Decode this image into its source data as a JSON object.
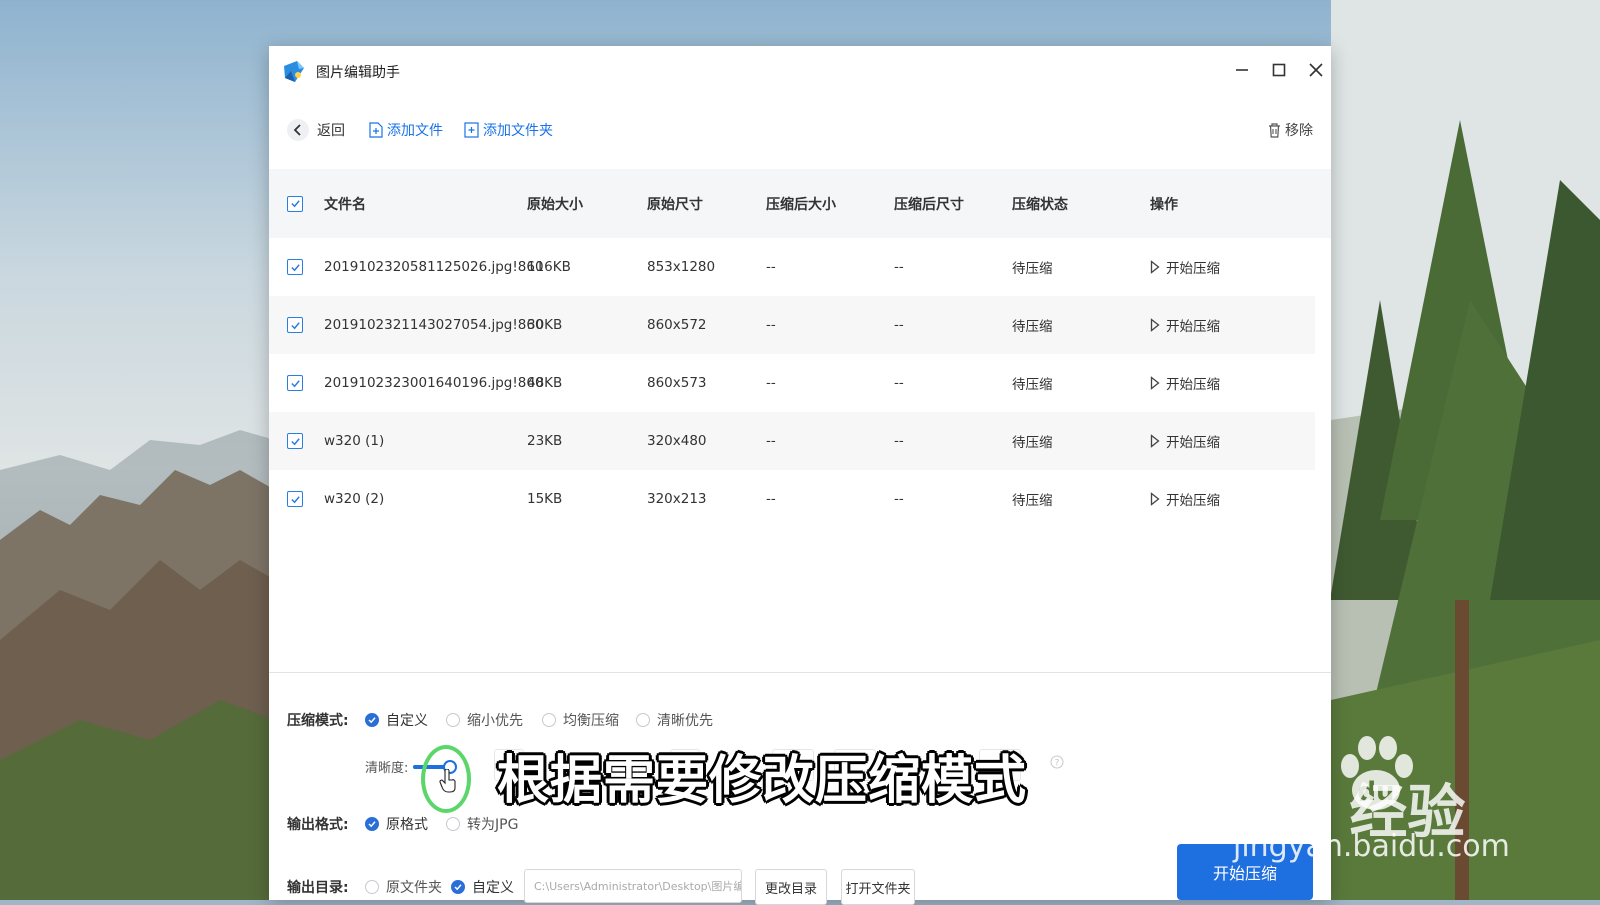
{
  "window": {
    "title": "图片编辑助手",
    "controls": {
      "minimize": "minimize-icon",
      "maximize": "maximize-icon",
      "close": "close-icon"
    }
  },
  "toolbar": {
    "back_label": "返回",
    "add_file_label": "添加文件",
    "add_folder_label": "添加文件夹",
    "remove_label": "移除"
  },
  "table": {
    "headers": {
      "name": "文件名",
      "original_size": "原始大小",
      "original_dim": "原始尺寸",
      "compressed_size": "压缩后大小",
      "compressed_dim": "压缩后尺寸",
      "status": "压缩状态",
      "action": "操作"
    },
    "rows": [
      {
        "name": "20191023205811250​26.jpg!860",
        "original_size": "116KB",
        "original_dim": "853x1280",
        "compressed_size": "--",
        "compressed_dim": "--",
        "status": "待压缩",
        "action": "开始压缩"
      },
      {
        "name": "20191023211430270​54.jpg!860",
        "original_size": "30KB",
        "original_dim": "860x572",
        "compressed_size": "--",
        "compressed_dim": "--",
        "status": "待压缩",
        "action": "开始压缩"
      },
      {
        "name": "20191023230016401​96.jpg!860",
        "original_size": "48KB",
        "original_dim": "860x573",
        "compressed_size": "--",
        "compressed_dim": "--",
        "status": "待压缩",
        "action": "开始压缩"
      },
      {
        "name": "w320 (1)",
        "original_size": "23KB",
        "original_dim": "320x480",
        "compressed_size": "--",
        "compressed_dim": "--",
        "status": "待压缩",
        "action": "开始压缩"
      },
      {
        "name": "w320 (2)",
        "original_size": "15KB",
        "original_dim": "320x213",
        "compressed_size": "--",
        "compressed_dim": "--",
        "status": "待压缩",
        "action": "开始压缩"
      }
    ]
  },
  "settings": {
    "mode_label": "压缩模式:",
    "mode_options": [
      "自定义",
      "缩小优先",
      "均衡压缩",
      "清晰优先"
    ],
    "mode_selected": "自定义",
    "clarity_label": "清晰度:",
    "clarity_level": 0.3,
    "format_label": "输出格式:",
    "format_options": [
      "原格式",
      "转为JPG"
    ],
    "format_selected": "原格式",
    "dir_label": "输出目录:",
    "dir_options": [
      "原文件夹",
      "自定义"
    ],
    "dir_selected": "自定义",
    "dir_path": "C:\\Users\\Administrator\\Desktop\\图片编辑",
    "change_dir_label": "更改目录",
    "open_folder_label": "打开文件夹",
    "start_label": "开始压缩"
  },
  "overlay": {
    "subtitle": "根据需要修改压缩模式",
    "watermark_brand": "Bai  经验",
    "watermark_url": "jingyan.baidu.com"
  },
  "colors": {
    "accent": "#1e6fe0",
    "check": "#2a7de1"
  }
}
